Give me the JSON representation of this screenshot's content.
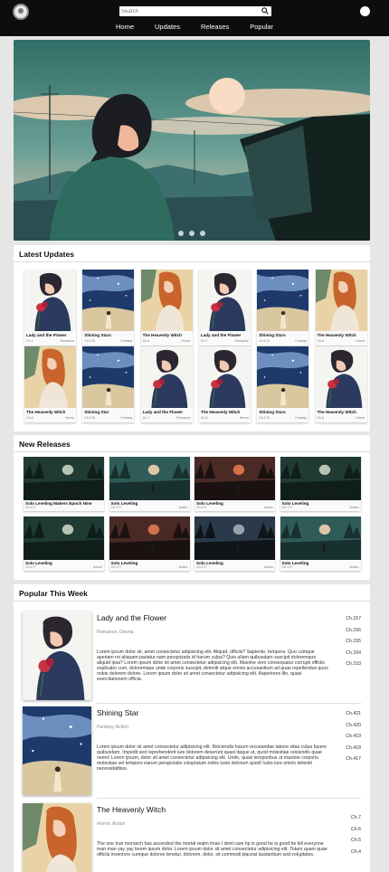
{
  "nav": {
    "search_placeholder": "Search",
    "links": [
      "Home",
      "Updates",
      "Releases",
      "Popular"
    ]
  },
  "hero": {
    "slide_count": 3
  },
  "latest": {
    "title": "Latest Updates",
    "items": [
      {
        "title": "Lady and the Flower",
        "chapter": "Ch.7",
        "genre": "Romance",
        "art": "lady"
      },
      {
        "title": "Shining Stars",
        "chapter": "Ch.176",
        "genre": "Fantasy",
        "art": "stars"
      },
      {
        "title": "The Heavenly Witch",
        "chapter": "Ch.6",
        "genre": "Horror",
        "art": "witch"
      },
      {
        "title": "Lady and the Flower",
        "chapter": "Ch.7",
        "genre": "Romance",
        "art": "lady"
      },
      {
        "title": "Shining Stars",
        "chapter": "Ch.176",
        "genre": "Fantasy",
        "art": "stars"
      },
      {
        "title": "The Heavenly Witch",
        "chapter": "Ch.6",
        "genre": "Horror",
        "art": "witch"
      },
      {
        "title": "The Heavenly Witch",
        "chapter": "Ch.6",
        "genre": "Horror",
        "art": "witch"
      },
      {
        "title": "Shining Star",
        "chapter": "Ch.176",
        "genre": "Fantasy",
        "art": "stars"
      },
      {
        "title": "Lady and the Flower",
        "chapter": "Ch.7",
        "genre": "Romance",
        "art": "lady"
      },
      {
        "title": "The Heavenly Witch",
        "chapter": "Ch.6",
        "genre": "Horror",
        "art": "lady"
      },
      {
        "title": "Shining Stars",
        "chapter": "Ch.176",
        "genre": "Fantasy",
        "art": "stars"
      },
      {
        "title": "The Heavenly Witch",
        "chapter": "Ch.6",
        "genre": "Horror",
        "art": "lady"
      }
    ]
  },
  "releases": {
    "title": "New Releases",
    "items": [
      {
        "title": "Solo Leveling Makers Epoch Nine",
        "chapter": "Ch.177",
        "genre": "",
        "art": "forest"
      },
      {
        "title": "Solo Leveling",
        "chapter": "Ch.177",
        "genre": "Action",
        "art": "sunset"
      },
      {
        "title": "Solo Leveling",
        "chapter": "Ch.177",
        "genre": "Action",
        "art": "dusk"
      },
      {
        "title": "Solo Leveling",
        "chapter": "Ch.177",
        "genre": "Action",
        "art": "forest"
      },
      {
        "title": "Solo Leveling",
        "chapter": "Ch.177",
        "genre": "Action",
        "art": "forest"
      },
      {
        "title": "Solo Leveling",
        "chapter": "Ch.177",
        "genre": "Action",
        "art": "dusk"
      },
      {
        "title": "Solo Leveling",
        "chapter": "Ch.177",
        "genre": "Action",
        "art": "night"
      },
      {
        "title": "Solo Leveling",
        "chapter": "Ch.177",
        "genre": "Action",
        "art": "sunset"
      }
    ]
  },
  "popular": {
    "title": "Popular This Week",
    "items": [
      {
        "title": "Lady and the Flower",
        "genre": "Romance, Drama",
        "art": "lady",
        "desc": "Lorem ipsum dolor sit, amet consectetur adipisicing elit. Aliquid, officiis? Sapiente, tempora. Quo cumque aperiam rei aliquam pariatur nam perspiciatis id harum culpa? Quis ullam quibusdam suscipit doloremque aliquid ipsa? Lorem ipsum dolor sit amet consectetur adipisicing elit. Maxime vero consequatur corrupti officiis explicabo cum, doloremque unde corporis suscipit, deleniti atque omnis accusantium ad quae repellendus quos nobis dolorem dolore. Lorem ipsum dolor sit amet consectetur adipisicing elit. Asperiores illo, quasi exercitationem officia.",
        "chapters": [
          "Ch.157",
          "Ch.156",
          "Ch.155",
          "Ch.154",
          "Ch.153"
        ]
      },
      {
        "title": "Shining Star",
        "genre": "Fantasy, Action",
        "art": "stars",
        "desc": "Lorem ipsum dolor sit amet consectetur adipisicing elit. Reiciendis harum recusandae labore vitae culpa facere quibusdam. Impedit sed reprehenderit iure dolorem deserunt quasi itaque ut, quod molestiae reiciendis quae nemo! Lorem ipsum, dolor sit amet consectetur adipisicing elit. Unde, quasi temporibus ut maxime corporis molestiae vel tempore earum perspiciatis voluptatum nobis iusto dolorum quod! Iusto iure omnis deleniti necessitatibus.",
        "chapters": [
          "Ch.421",
          "Ch.420",
          "Ch.419",
          "Ch.418",
          "Ch.417"
        ]
      },
      {
        "title": "The Heavenly Witch",
        "genre": "Horror, Action",
        "art": "witch",
        "desc": "The one true monarch has ascended the mortal realm lmao I dont care hp is good he is good he kill everyone man man yay yay lorem ipsum dolor. Lorem ipsum dolor sit amet consectetur adipisicing elit. Totam quam quae officiis inventore cumque dolores tenetur, dolorem, dolor, sit commodi placeat laudantium sed voluptates.",
        "chapters": [
          "Ch.7",
          "Ch.6",
          "Ch.5",
          "Ch.4"
        ]
      }
    ]
  },
  "colors": {
    "topbar": "#0d0d0d",
    "page_bg": "#e6e6e6",
    "teal": "#2f6e66",
    "peach": "#f5c9a8"
  }
}
